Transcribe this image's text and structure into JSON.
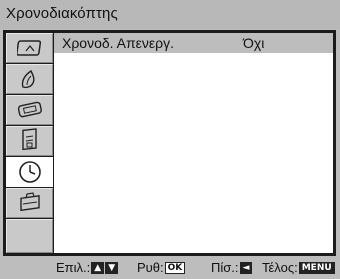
{
  "header": {
    "title": "Χρονοδιακόπτης"
  },
  "sidebar": {
    "tabs": [
      {
        "icon": "picture-icon",
        "selected": false
      },
      {
        "icon": "sound-icon",
        "selected": false
      },
      {
        "icon": "screen-control-icon",
        "selected": false
      },
      {
        "icon": "features-icon",
        "selected": false
      },
      {
        "icon": "timer-clock-icon",
        "selected": true
      },
      {
        "icon": "setup-toolbox-icon",
        "selected": false
      },
      {
        "icon": "",
        "selected": false
      }
    ]
  },
  "menu": {
    "rows": [
      {
        "label": "Χρονοδ. Απενεργ.",
        "value": "Όχι",
        "selected": true
      }
    ]
  },
  "footer": {
    "select_label": "Επιλ.:",
    "select_keys": [
      "▲",
      "▼"
    ],
    "set_label": "Ρυθ:",
    "set_key": "OK",
    "back_label": "Πίσ.:",
    "back_key": "◄",
    "exit_label": "Τέλος:",
    "exit_key": "MENU"
  }
}
